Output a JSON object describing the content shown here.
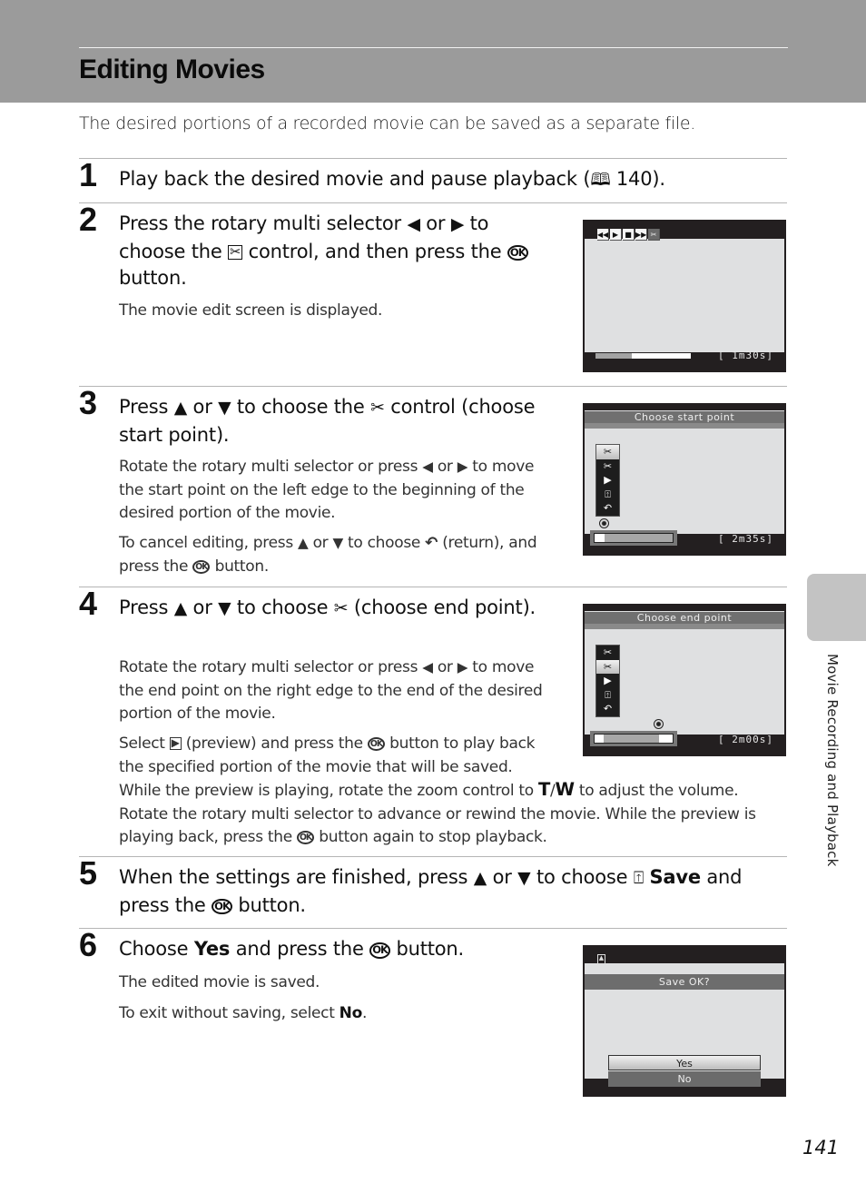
{
  "page": {
    "title": "Editing Movies",
    "intro": "The desired portions of a recorded movie can be saved as a separate file.",
    "side_tab_label": "Movie Recording and Playback",
    "page_number": "141"
  },
  "icons": {
    "left": "◀",
    "right": "▶",
    "up": "▲",
    "down": "▼",
    "ok": "OK",
    "book": "🕮",
    "scissors": "✂",
    "return": "↶",
    "play": "▶",
    "save": "⍐"
  },
  "steps": [
    {
      "number": "1",
      "heading_parts": [
        "Play back the desired movie and pause playback (",
        " 140)."
      ]
    },
    {
      "number": "2",
      "heading_parts": [
        "Press the rotary multi selector ",
        " or ",
        " to choose the ",
        " control, and then press the ",
        " button."
      ],
      "body": [
        "The movie edit screen is displayed."
      ]
    },
    {
      "number": "3",
      "heading_parts": [
        "Press ",
        " or ",
        " to choose the ",
        " control (choose start point)."
      ],
      "body_1_parts": [
        "Rotate the rotary multi selector or press ",
        " or ",
        " to move the start point on the left edge to the beginning of the desired portion of the movie."
      ],
      "body_2_parts": [
        "To cancel editing, press ",
        " or ",
        " to choose ",
        " (return), and press the ",
        " button."
      ]
    },
    {
      "number": "4",
      "heading_parts": [
        "Press ",
        " or ",
        " to choose ",
        " (choose end point)."
      ],
      "body_1_parts": [
        "Rotate the rotary multi selector or press ",
        " or ",
        " to move the end point on the right edge to the end of the desired portion of the movie."
      ],
      "body_2_parts": [
        "Select ",
        " (preview) and press the ",
        " button to play back the specified portion of the movie that will be saved."
      ],
      "body_3_parts": [
        "While the preview is playing, rotate the zoom control to ",
        "T",
        "/",
        "W",
        " to adjust the volume. Rotate the rotary multi selector to advance or rewind the movie. While the preview is playing back, press the ",
        " button again to stop playback."
      ]
    },
    {
      "number": "5",
      "heading_parts": [
        "When the settings are finished, press ",
        " or ",
        " to choose ",
        "Save",
        " and press the ",
        " button."
      ]
    },
    {
      "number": "6",
      "heading_parts": [
        "Choose ",
        "Yes",
        " and press the ",
        " button."
      ],
      "body_1": "The edited movie is saved.",
      "body_2_parts": [
        "To exit without saving, select ",
        "No",
        "."
      ]
    }
  ],
  "screens": {
    "playback": {
      "controls": [
        "rewind",
        "play",
        "stop",
        "advance",
        "edit"
      ],
      "counter": "[  1m30s]",
      "progress": 0.38
    },
    "start_point": {
      "title": "Choose start point",
      "menu": [
        "choose-start",
        "choose-end",
        "preview",
        "save",
        "return"
      ],
      "selected": 0,
      "counter": "[   2m35s]",
      "range_start": 0.0,
      "range_end": 0.13
    },
    "end_point": {
      "title": "Choose end point",
      "menu": [
        "choose-start",
        "choose-end",
        "preview",
        "save",
        "return"
      ],
      "selected": 1,
      "counter": "[   2m00s]",
      "range_start": 0.0,
      "range_end": 0.82
    },
    "save_dialog": {
      "title": "Save OK?",
      "options": [
        "Yes",
        "No"
      ],
      "selected": 0
    }
  }
}
